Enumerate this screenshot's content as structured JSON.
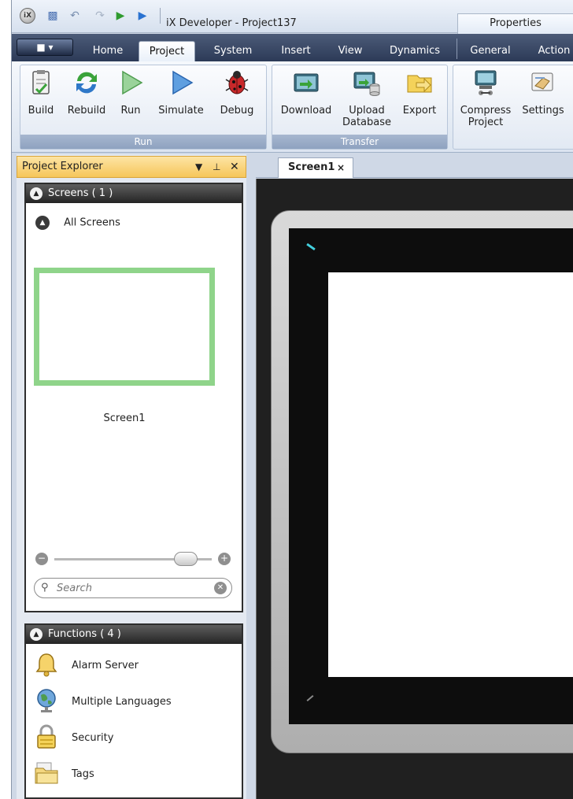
{
  "titlebar": {
    "logo": "iX",
    "title": "iX Developer - Project137",
    "properties_tab": "Properties",
    "quick_access_icons": [
      "save-icon",
      "undo-icon",
      "redo-icon",
      "run-icon",
      "simulate-icon"
    ]
  },
  "ribbon_tabs": {
    "home": "Home",
    "project": "Project",
    "system": "System",
    "insert": "Insert",
    "view": "View",
    "dynamics": "Dynamics",
    "general": "General",
    "action": "Action"
  },
  "ribbon_groups": {
    "run": {
      "label": "Run",
      "buttons": {
        "build": "Build",
        "rebuild": "Rebuild",
        "run": "Run",
        "simulate": "Simulate",
        "debug": "Debug"
      }
    },
    "transfer": {
      "label": "Transfer",
      "buttons": {
        "download": "Download",
        "upload_line1": "Upload",
        "upload_line2": "Database",
        "export": "Export"
      }
    },
    "project": {
      "buttons": {
        "compress_line1": "Compress",
        "compress_line2": "Project",
        "settings": "Settings"
      }
    }
  },
  "explorer": {
    "title": "Project Explorer",
    "screens_header": "Screens ( 1 )",
    "all_screens": "All Screens",
    "screen_name": "Screen1",
    "search_placeholder": "Search",
    "functions_header": "Functions ( 4 )",
    "functions": [
      {
        "label": "Alarm Server",
        "icon": "bell-icon"
      },
      {
        "label": "Multiple Languages",
        "icon": "globe-icon"
      },
      {
        "label": "Security",
        "icon": "lock-icon"
      },
      {
        "label": "Tags",
        "icon": "tags-folder-icon"
      }
    ]
  },
  "editor": {
    "tab_label": "Screen1",
    "tab_close": "×"
  },
  "colors": {
    "accent": "#f6c65a",
    "ribbon_dark": "#2c3a57",
    "thumbnail_border": "#8fd48a",
    "led": "#43d0de"
  }
}
